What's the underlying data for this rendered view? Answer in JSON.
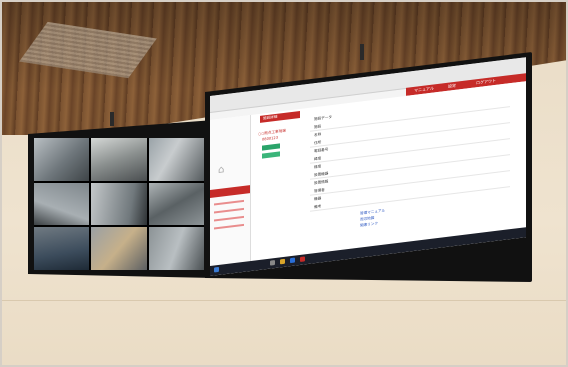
{
  "photo": {
    "right_screen": {
      "browser_tab_text": "",
      "header_tabs": [
        "マニュアル",
        "設定",
        "ログアウト"
      ],
      "section_badge": "施設詳細",
      "facility_name": "○○拠点工事現場",
      "facility_code": "0800123",
      "detail_heading": "施設データ",
      "detail_labels": [
        "施設",
        "名称",
        "住所",
        "電話番号",
        "緯度",
        "経度",
        "設置機器",
        "設置情報",
        "管理者",
        "機器",
        "備考"
      ],
      "link_labels": [
        "管理マニュアル",
        "周辺地図",
        "関連リンク"
      ],
      "accent_color": "#c62b28"
    },
    "colors": {
      "ceiling": "#7a5230",
      "wall": "#efe3cf",
      "bezel": "#111111"
    }
  }
}
